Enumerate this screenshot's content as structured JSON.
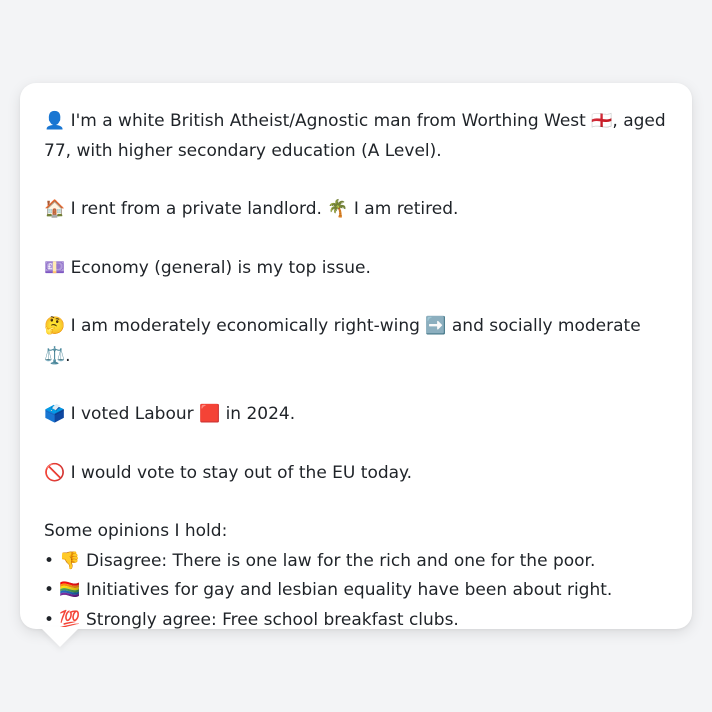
{
  "bubble": {
    "intro": "👤 I'm a white British Atheist/Agnostic man from Worthing West 🏴󠁧󠁢󠁥󠁮󠁧󠁿, aged 77, with higher secondary education (A Level).",
    "housing": "🏠 I rent from a private landlord. 🌴 I am retired.",
    "issue": "💷 Economy (general) is my top issue.",
    "politics": "🤔 I am moderately economically right-wing ➡️ and socially moderate ⚖️.",
    "vote": "🗳️ I voted Labour 🟥 in 2024.",
    "eu": "🚫 I would vote to stay out of the EU today.",
    "opinions_heading": "Some opinions I hold:",
    "opinions": [
      "• 👎 Disagree: There is one law for the rich and one for the poor.",
      "• 🏳️‍🌈 Initiatives for gay and lesbian equality have been about right.",
      "• 💯 Strongly agree: Free school breakfast clubs."
    ]
  }
}
